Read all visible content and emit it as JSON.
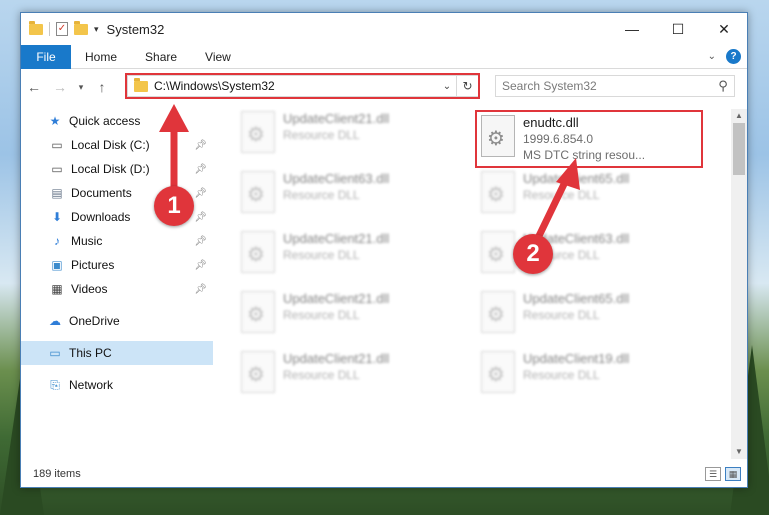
{
  "window": {
    "title": "System32",
    "controls": {
      "minimize": "—",
      "maximize": "☐",
      "close": "✕"
    }
  },
  "ribbon": {
    "file_label": "File",
    "tabs": [
      "Home",
      "Share",
      "View"
    ]
  },
  "address": {
    "path": "C:\\Windows\\System32"
  },
  "search": {
    "placeholder": "Search System32"
  },
  "sidebar": {
    "quick_access": "Quick access",
    "quick_items": [
      {
        "label": "Local Disk (C:)",
        "icon": "drive-icon"
      },
      {
        "label": "Local Disk (D:)",
        "icon": "drive-icon"
      },
      {
        "label": "Documents",
        "icon": "documents-icon"
      },
      {
        "label": "Downloads",
        "icon": "downloads-icon"
      },
      {
        "label": "Music",
        "icon": "music-icon"
      },
      {
        "label": "Pictures",
        "icon": "pictures-icon"
      },
      {
        "label": "Videos",
        "icon": "videos-icon"
      }
    ],
    "onedrive": "OneDrive",
    "this_pc": "This PC",
    "network": "Network"
  },
  "files": [
    {
      "name": "UpdateClient21.dll",
      "type": "Resource DLL"
    },
    {
      "name": "UpdateClient63.dll",
      "type": "Resource DLL"
    },
    {
      "name": "UpdateClient21.dll",
      "type": "Resource DLL"
    },
    {
      "name": "UpdateClient21.dll",
      "type": "Resource DLL"
    },
    {
      "name": "UpdateClient21.dll",
      "type": "Resource DLL"
    },
    {
      "name": "enudtc.dll",
      "version": "1999.6.854.0",
      "description": "MS DTC string resou..."
    },
    {
      "name": "UpdateClient65.dll",
      "type": "Resource DLL"
    },
    {
      "name": "UpdateClient63.dll",
      "type": "Resource DLL"
    },
    {
      "name": "UpdateClient65.dll",
      "type": "Resource DLL"
    },
    {
      "name": "UpdateClient19.dll",
      "type": "Resource DLL"
    }
  ],
  "status": {
    "item_count": "189 items"
  },
  "annotations": {
    "badge1": "1",
    "badge2": "2",
    "color": "#e0353b"
  }
}
